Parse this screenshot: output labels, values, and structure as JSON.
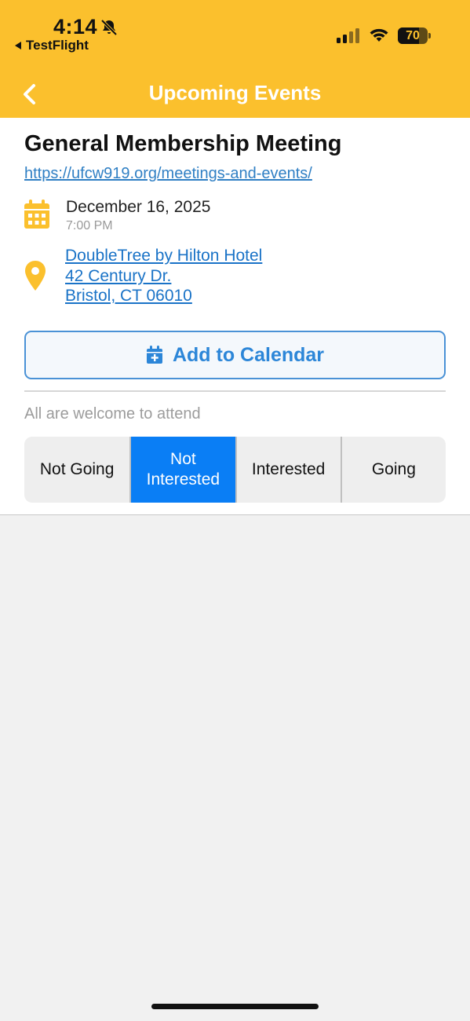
{
  "status_bar": {
    "time": "4:14",
    "back_app": "TestFlight",
    "battery_level": "70",
    "battery_percent": 70,
    "icons": [
      "bell-slash-icon",
      "signal-icon",
      "wifi-icon",
      "battery-icon"
    ]
  },
  "nav": {
    "title": "Upcoming Events",
    "back_icon": "chevron-left-icon"
  },
  "event": {
    "title": "General Membership Meeting",
    "url": "https://ufcw919.org/meetings-and-events/",
    "date": "December 16, 2025",
    "time": "7:00 PM",
    "location": {
      "line1": "DoubleTree by Hilton Hotel",
      "line2": "42 Century Dr.",
      "line3": "Bristol, CT 06010"
    },
    "add_to_calendar": "Add to Calendar",
    "note": "All are welcome to attend"
  },
  "rsvp": {
    "options": [
      "Not Going",
      "Not Interested",
      "Interested",
      "Going"
    ],
    "selected": "Not Interested"
  },
  "colors": {
    "header": "#fbc02d",
    "accent": "#0a7ef5",
    "link": "#1a73c7",
    "background": "#f1f1f1"
  }
}
